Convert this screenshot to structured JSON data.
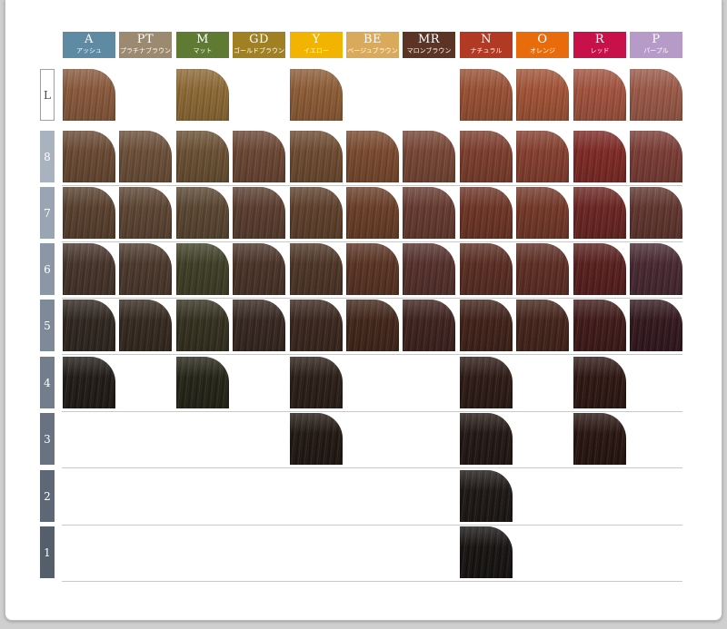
{
  "columns": [
    {
      "code": "A",
      "name": "アッシュ",
      "color": "#5f8aa3"
    },
    {
      "code": "PT",
      "name": "プラチナブラウン",
      "color": "#9b8a70"
    },
    {
      "code": "M",
      "name": "マット",
      "color": "#5e7a33"
    },
    {
      "code": "GD",
      "name": "ゴールドブラウン",
      "color": "#a08023"
    },
    {
      "code": "Y",
      "name": "イエロー",
      "color": "#f2b400"
    },
    {
      "code": "BE",
      "name": "ベージュブラウン",
      "color": "#d9aa5c"
    },
    {
      "code": "MR",
      "name": "マロンブラウン",
      "color": "#5b3425"
    },
    {
      "code": "N",
      "name": "ナチュラル",
      "color": "#b23a25"
    },
    {
      "code": "O",
      "name": "オレンジ",
      "color": "#e96c0c"
    },
    {
      "code": "R",
      "name": "レッド",
      "color": "#c8104a"
    },
    {
      "code": "P",
      "name": "パープル",
      "color": "#b69bc9"
    }
  ],
  "rows": [
    {
      "level": "L",
      "label_color": "#ffffff",
      "swatches": [
        "#8a5a3c",
        null,
        "#8e6a35",
        null,
        "#8f5d36",
        null,
        null,
        "#9a5134",
        "#a35436",
        "#a3533e",
        "#9c5a48"
      ]
    },
    {
      "level": "8",
      "label_color": "#a9b3c0",
      "swatches": [
        "#6a4a33",
        "#6c4f38",
        "#6a5032",
        "#6b4633",
        "#6e4b30",
        "#7a4a2e",
        "#774635",
        "#7d3e2d",
        "#863f2e",
        "#7f2a25",
        "#7b3d35"
      ]
    },
    {
      "level": "7",
      "label_color": "#9aa5b3",
      "swatches": [
        "#59402d",
        "#5d4432",
        "#5a4631",
        "#5a3d2e",
        "#5f402b",
        "#6a3e27",
        "#663a2f",
        "#6e3526",
        "#743828",
        "#6b2521",
        "#61352f"
      ]
    },
    {
      "level": "6",
      "label_color": "#8c97a6",
      "swatches": [
        "#46342a",
        "#4b382c",
        "#3f3f26",
        "#4a3328",
        "#4e3526",
        "#5a3322",
        "#55302b",
        "#5a2d22",
        "#5e2e24",
        "#581f1e",
        "#482831"
      ]
    },
    {
      "level": "5",
      "label_color": "#7f8a99",
      "swatches": [
        "#30261f",
        "#35291f",
        "#34301f",
        "#362620",
        "#3a271e",
        "#42261a",
        "#3e221e",
        "#402219",
        "#44241b",
        "#3f1a18",
        "#33181e"
      ]
    },
    {
      "level": "4",
      "label_color": "#737e8c",
      "swatches": [
        "#211b16",
        null,
        "#242417",
        null,
        "#2b1e17",
        null,
        null,
        "#2d1a15",
        null,
        "#2e1712",
        null
      ]
    },
    {
      "level": "3",
      "label_color": "#687280",
      "swatches": [
        null,
        null,
        null,
        null,
        "#221812",
        null,
        null,
        "#221713",
        null,
        "#281510",
        null
      ]
    },
    {
      "level": "2",
      "label_color": "#5e6775",
      "swatches": [
        null,
        null,
        null,
        null,
        null,
        null,
        null,
        "#1c1714",
        null,
        null,
        null
      ]
    },
    {
      "level": "1",
      "label_color": "#555e6b",
      "swatches": [
        null,
        null,
        null,
        null,
        null,
        null,
        null,
        "#161311",
        null,
        null,
        null
      ]
    }
  ]
}
